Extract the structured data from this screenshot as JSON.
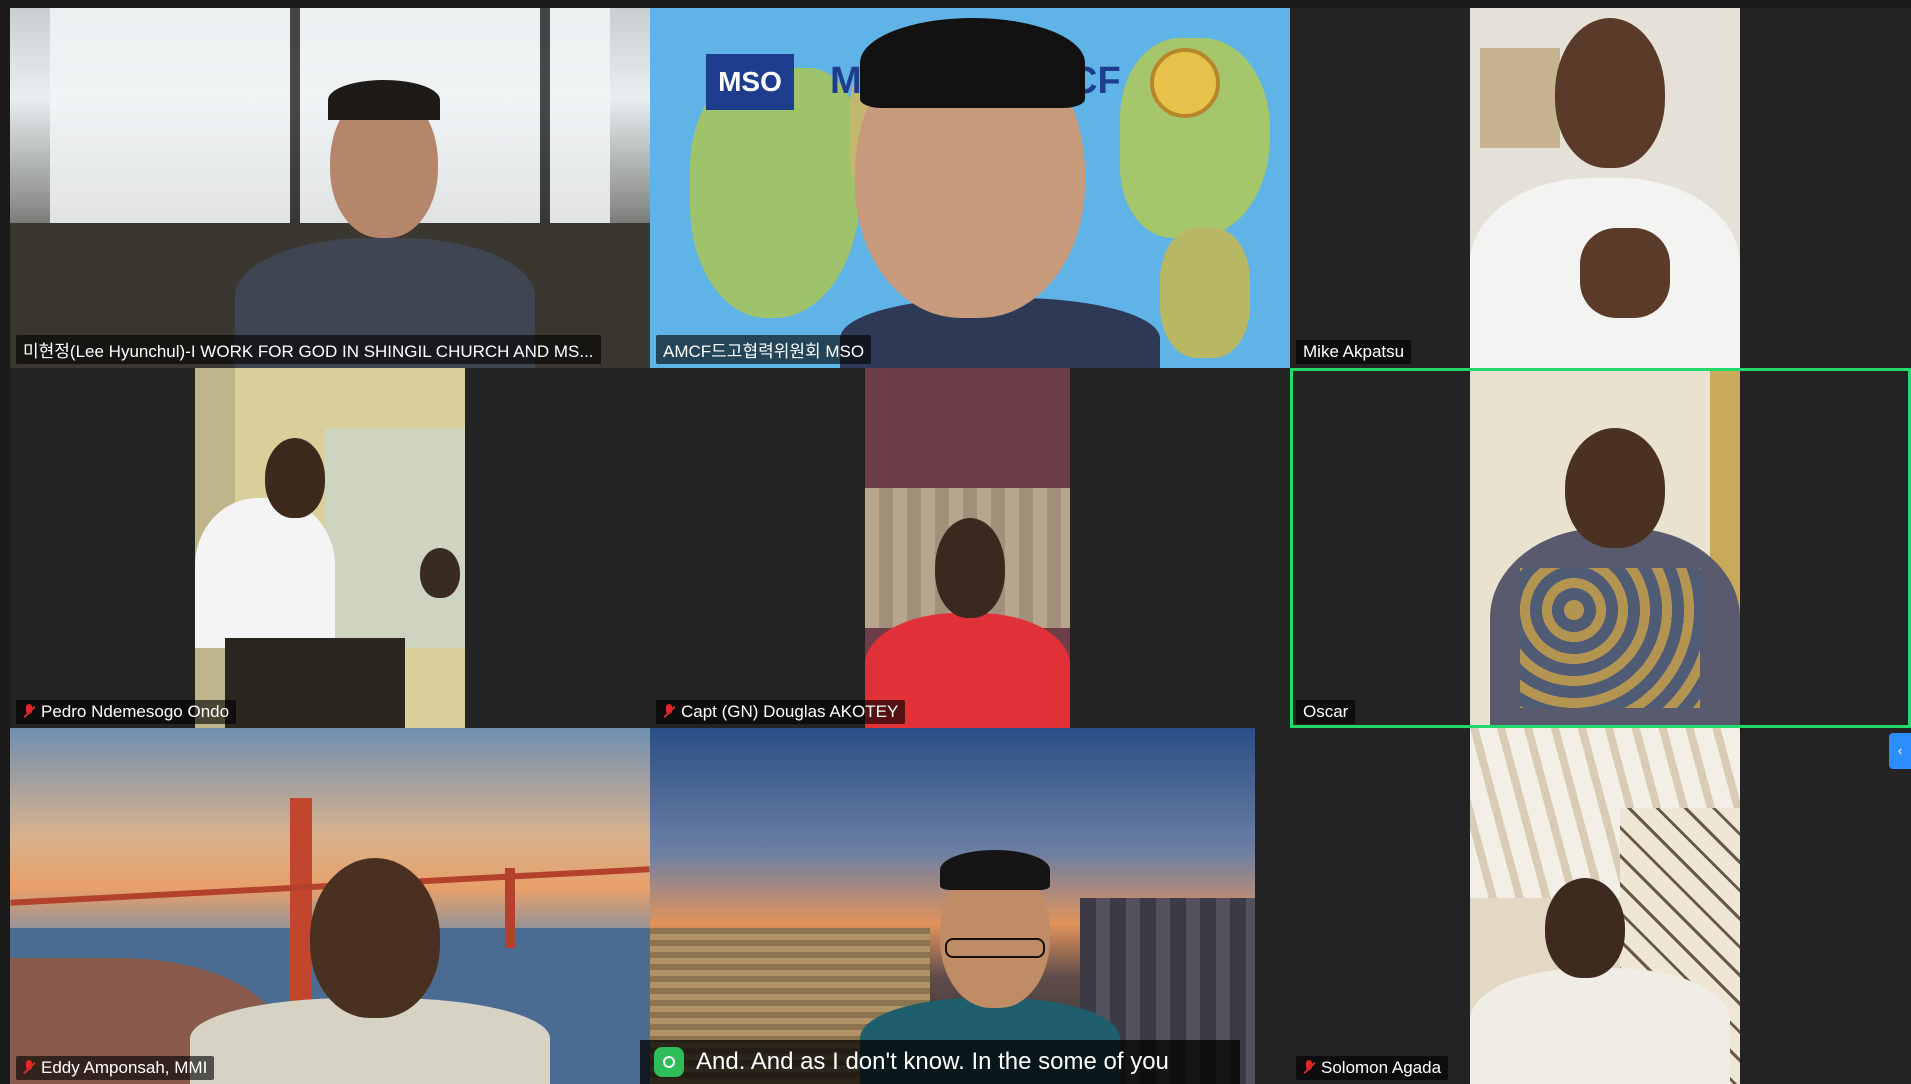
{
  "participants": [
    {
      "name": "미현정(Lee Hyunchul)-I WORK FOR GOD IN SHINGIL CHURCH AND MS...",
      "muted": false
    },
    {
      "name": "AMCF드고협력위원회 MSO",
      "muted": false
    },
    {
      "name": "Mike Akpatsu",
      "muted": false
    },
    {
      "name": "Pedro Ndemesogo Ondo",
      "muted": true
    },
    {
      "name": "Capt (GN) Douglas AKOTEY",
      "muted": true
    },
    {
      "name": "Oscar",
      "muted": false
    },
    {
      "name": "Eddy Amponsah, MMI",
      "muted": true
    },
    {
      "name": "Solomon Agada",
      "muted": true
    }
  ],
  "background_logo": {
    "left_text": "MSO",
    "partial_text_1": "M",
    "partial_text_2": "CF"
  },
  "caption": {
    "text": "And. And as I don't know. In the some of you"
  },
  "colors": {
    "active_speaker": "#23d96b",
    "muted_mic": "#e02828",
    "caption_icon": "#2ebd59",
    "side_tab": "#2d8cff"
  }
}
